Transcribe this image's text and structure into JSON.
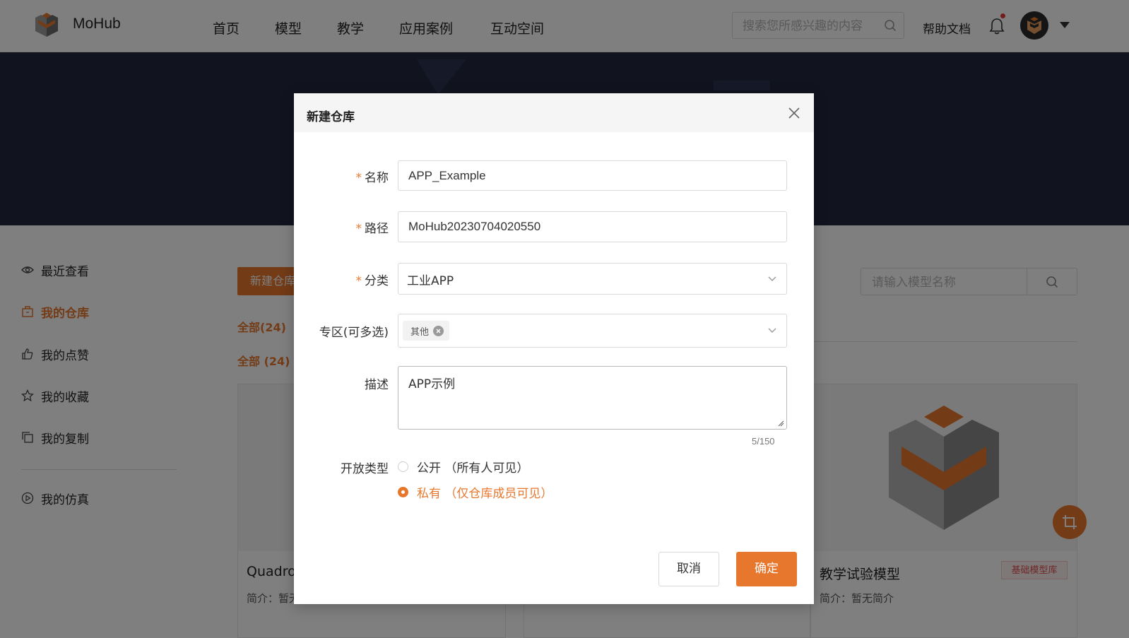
{
  "header": {
    "brand": "MoHub",
    "nav": [
      "首页",
      "模型",
      "教学",
      "应用案例",
      "互动空间"
    ],
    "search_placeholder": "搜索您所感兴趣的内容",
    "help_label": "帮助文档"
  },
  "sidebar": {
    "items": [
      {
        "label": "最近查看",
        "icon": "eye-icon"
      },
      {
        "label": "我的仓库",
        "icon": "repository-icon",
        "active": true
      },
      {
        "label": "我的点赞",
        "icon": "thumbs-up-icon"
      },
      {
        "label": "我的收藏",
        "icon": "star-icon"
      },
      {
        "label": "我的复制",
        "icon": "copy-icon"
      },
      {
        "label": "我的仿真",
        "icon": "play-circle-icon"
      }
    ]
  },
  "main": {
    "new_repo_label": "新建仓库",
    "filter_all": "全部(24)",
    "filter_all_2": "全部 (24)",
    "model_search_placeholder": "请输入模型名称",
    "cards": [
      {
        "title": "Quadrotor",
        "desc": "简介：暂无简介"
      },
      {
        "title": "",
        "desc": ""
      },
      {
        "title": "教学试验模型",
        "desc": "简介：暂无简介",
        "tag": "基础模型库"
      }
    ]
  },
  "modal": {
    "title": "新建仓库",
    "fields": {
      "name_label": "名称",
      "name_value": "APP_Example",
      "path_label": "路径",
      "path_value": "MoHub20230704020550",
      "category_label": "分类",
      "category_value": "工业APP",
      "zone_label": "专区(可多选)",
      "zone_chips": [
        "其他"
      ],
      "desc_label": "描述",
      "desc_value": "APP示例",
      "desc_counter": "5/150",
      "access_label": "开放类型",
      "access_options": [
        {
          "label": "公开 （所有人可见）",
          "selected": false
        },
        {
          "label": "私有 （仅仓库成员可见）",
          "selected": true
        }
      ]
    },
    "cancel_label": "取消",
    "ok_label": "确定"
  },
  "colors": {
    "accent": "#e8772e",
    "banner": "#22283f",
    "overlay": "rgba(0,0,0,0.5)"
  }
}
